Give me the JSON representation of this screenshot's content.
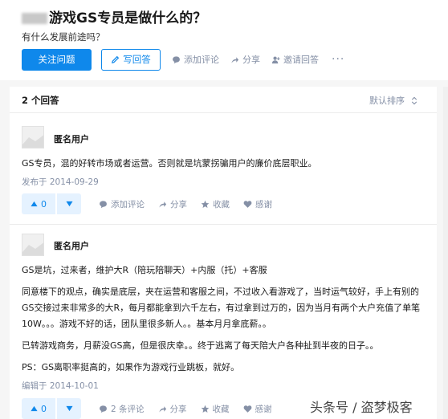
{
  "question": {
    "title": "游戏GS专员是做什么的？",
    "subtitle": "有什么发展前途吗？",
    "actions": {
      "follow": "关注问题",
      "write": "写回答",
      "comment": "添加评论",
      "share": "分享",
      "invite": "邀请回答",
      "more": "···"
    }
  },
  "answers_header": {
    "count": "2 个回答",
    "sort": "默认排序"
  },
  "answers": [
    {
      "author": "匿名用户",
      "paragraphs": [
        "GS专员，混的好转市场或者运营。否则就是坑蒙拐骗用户的廉价底层职业。"
      ],
      "date": "发布于 2014-09-29",
      "votes": "0",
      "comment": "添加评论",
      "share": "分享",
      "collect": "收藏",
      "thanks": "感谢"
    },
    {
      "author": "匿名用户",
      "paragraphs": [
        "GS是坑，过来者，维护大R（陪玩陪聊天）+内服（托）+客服",
        "同意楼下的观点，确实是底层，夹在运营和客服之间，不过收入看游戏了，当时运气较好，手上有别的GS交接过来非常多的大R，每月都能拿到六千左右，有过拿到过万的，因为当月有两个大户充值了单笔10W。。。游戏不好的话，团队里很多新人。。基本月月拿底薪。。",
        "已转游戏商务，月薪没GS高，但是很庆幸。。终于逃离了每天陪大户各种扯到半夜的日子。。",
        "PS：GS离职率挺高的，如果作为游戏行业跳板，就好。"
      ],
      "date": "编辑于 2014-10-01",
      "votes": "0",
      "comment": "2 条评论",
      "share": "分享",
      "collect": "收藏",
      "thanks": "感谢"
    }
  ],
  "watermark": "头条号 / 盗梦极客",
  "colors": {
    "accent": "#0f88eb",
    "muted": "#8590a6"
  }
}
